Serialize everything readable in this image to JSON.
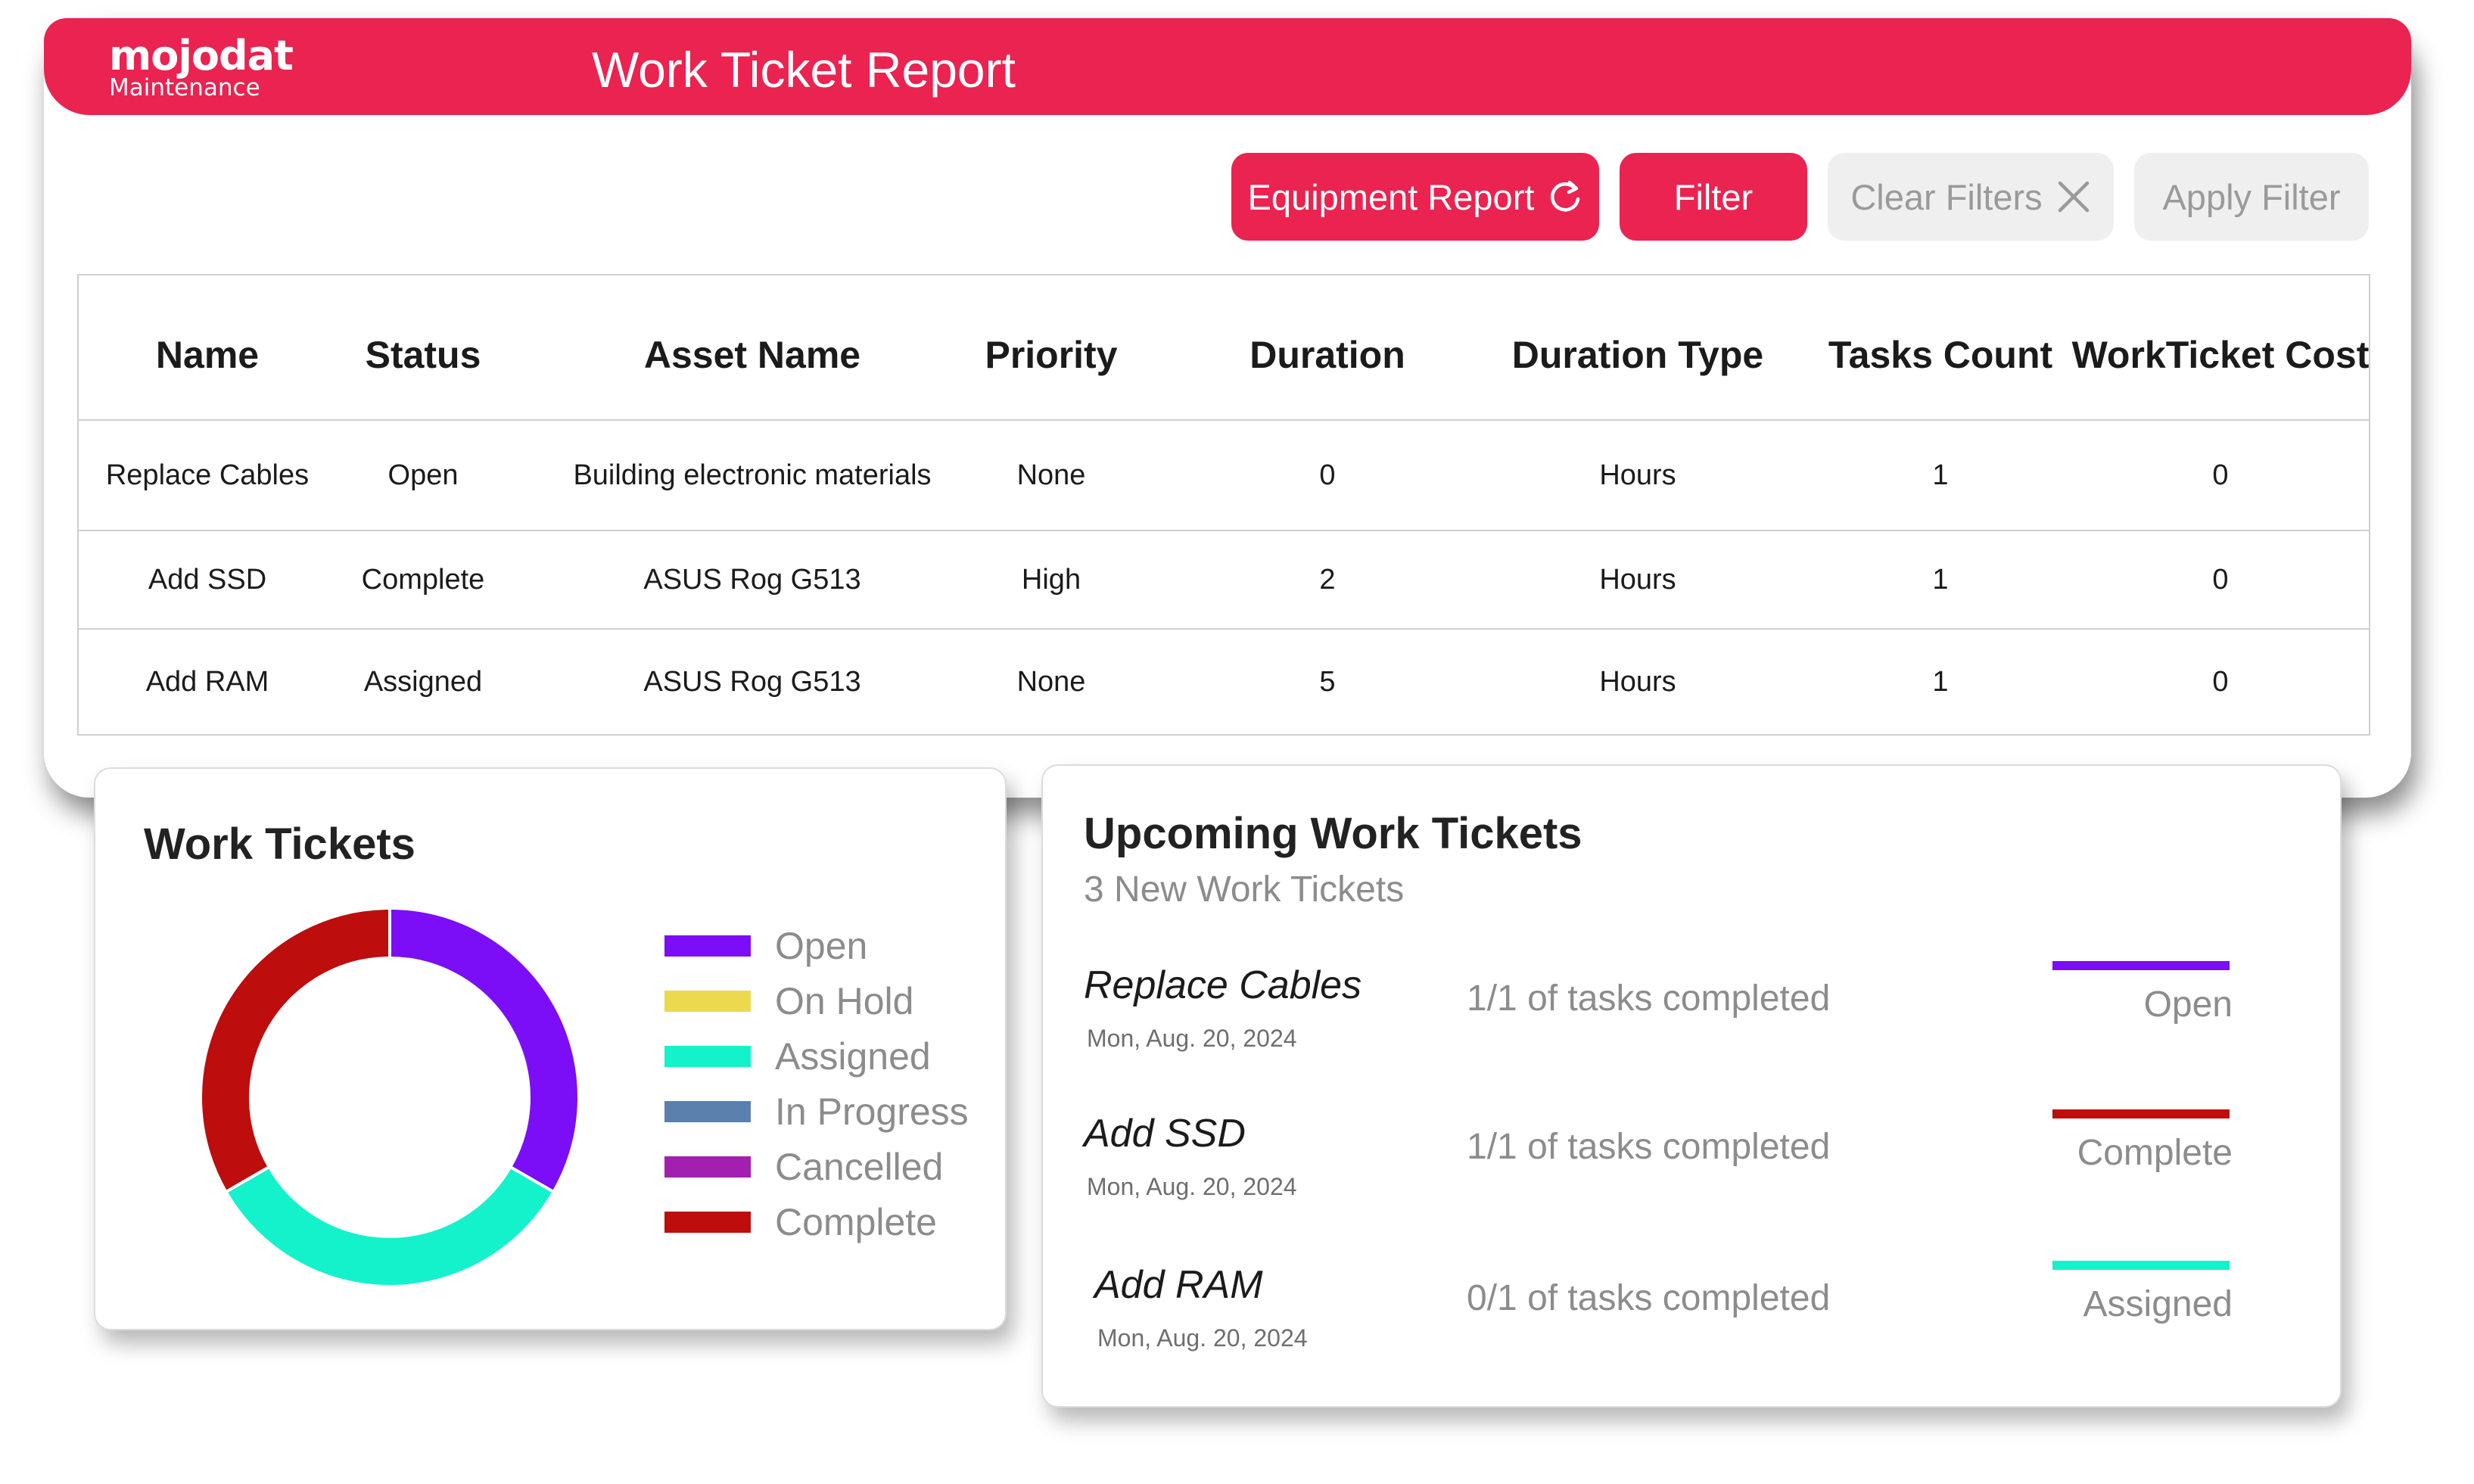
{
  "header": {
    "logo_name": "mojodat",
    "logo_sub": "Maintenance",
    "title": "Work Ticket Report"
  },
  "toolbar": {
    "equipment_report_label": "Equipment Report",
    "filter_label": "Filter",
    "clear_filters_label": "Clear Filters",
    "apply_filter_label": "Apply Filter",
    "icons": {
      "equipment_report": "refresh-icon",
      "clear_filters": "close-icon"
    }
  },
  "table": {
    "columns": [
      "Name",
      "Status",
      "Asset Name",
      "Priority",
      "Duration",
      "Duration Type",
      "Tasks Count",
      "WorkTicket Cost"
    ],
    "rows": [
      [
        "Replace Cables",
        "Open",
        "Building electronic materials",
        "None",
        "0",
        "Hours",
        "1",
        "0"
      ],
      [
        "Add SSD",
        "Complete",
        "ASUS Rog G513",
        "High",
        "2",
        "Hours",
        "1",
        "0"
      ],
      [
        "Add RAM",
        "Assigned",
        "ASUS Rog G513",
        "None",
        "5",
        "Hours",
        "1",
        "0"
      ]
    ]
  },
  "work_tickets": {
    "title": "Work Tickets",
    "legend": [
      {
        "label": "Open",
        "color": "#7b0df7"
      },
      {
        "label": "On Hold",
        "color": "#ecd94d"
      },
      {
        "label": "Assigned",
        "color": "#14f2cc"
      },
      {
        "label": "In Progress",
        "color": "#5b80ae"
      },
      {
        "label": "Cancelled",
        "color": "#a21fb0"
      },
      {
        "label": "Complete",
        "color": "#bd0d0d"
      }
    ]
  },
  "chart_data": {
    "type": "pie",
    "title": "Work Tickets",
    "categories": [
      "Open",
      "On Hold",
      "Assigned",
      "In Progress",
      "Cancelled",
      "Complete"
    ],
    "values": [
      1,
      0,
      1,
      0,
      0,
      1
    ],
    "colors": [
      "#7b0df7",
      "#ecd94d",
      "#14f2cc",
      "#5b80ae",
      "#a21fb0",
      "#bd0d0d"
    ],
    "legend_position": "right",
    "donut": true
  },
  "upcoming": {
    "title": "Upcoming Work Tickets",
    "subtitle": "3 New Work Tickets",
    "tickets": [
      {
        "name": "Replace Cables",
        "date": "Mon, Aug. 20, 2024",
        "progress": "1/1 of tasks completed",
        "status": "Open",
        "color": "#7b0df7"
      },
      {
        "name": "Add SSD",
        "date": "Mon, Aug. 20, 2024",
        "progress": "1/1 of tasks completed",
        "status": "Complete",
        "color": "#bd0d0d"
      },
      {
        "name": "Add RAM",
        "date": "Mon, Aug. 20, 2024",
        "progress": "0/1 of tasks completed",
        "status": "Assigned",
        "color": "#14f2cc"
      }
    ]
  }
}
